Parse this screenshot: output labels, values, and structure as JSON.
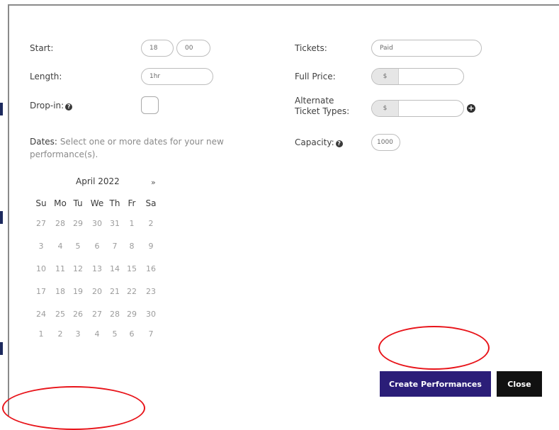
{
  "form": {
    "start_label": "Start:",
    "start_hour": "18",
    "start_minute": "00",
    "length_label": "Length:",
    "length_value": "1hr",
    "dropin_label": "Drop-in:",
    "dates_label": "Dates:",
    "dates_help": "Select one or more dates for your new performance(s).",
    "tickets_label": "Tickets:",
    "tickets_value": "Paid",
    "full_price_label": "Full Price:",
    "currency_symbol": "$",
    "alternate_label": "Alternate Ticket Types:",
    "capacity_label": "Capacity:",
    "capacity_value": "1000"
  },
  "icons": {
    "help": "question-circle-icon",
    "add": "plus-circle-icon",
    "next": "double-chevron-right-icon"
  },
  "calendar": {
    "month_label": "April 2022",
    "next_glyph": "»",
    "weekdays": [
      "Su",
      "Mo",
      "Tu",
      "We",
      "Th",
      "Fr",
      "Sa"
    ],
    "weeks": [
      [
        "27",
        "28",
        "29",
        "30",
        "31",
        "1",
        "2"
      ],
      [
        "3",
        "4",
        "5",
        "6",
        "7",
        "8",
        "9"
      ],
      [
        "10",
        "11",
        "12",
        "13",
        "14",
        "15",
        "16"
      ],
      [
        "17",
        "18",
        "19",
        "20",
        "21",
        "22",
        "23"
      ],
      [
        "24",
        "25",
        "26",
        "27",
        "28",
        "29",
        "30"
      ],
      [
        "1",
        "2",
        "3",
        "4",
        "5",
        "6",
        "7"
      ]
    ]
  },
  "actions": {
    "create_label": "Create Performances",
    "close_label": "Close"
  },
  "colors": {
    "primary_button": "#2b1e78",
    "close_button": "#111111",
    "annotation": "#e8141a"
  }
}
